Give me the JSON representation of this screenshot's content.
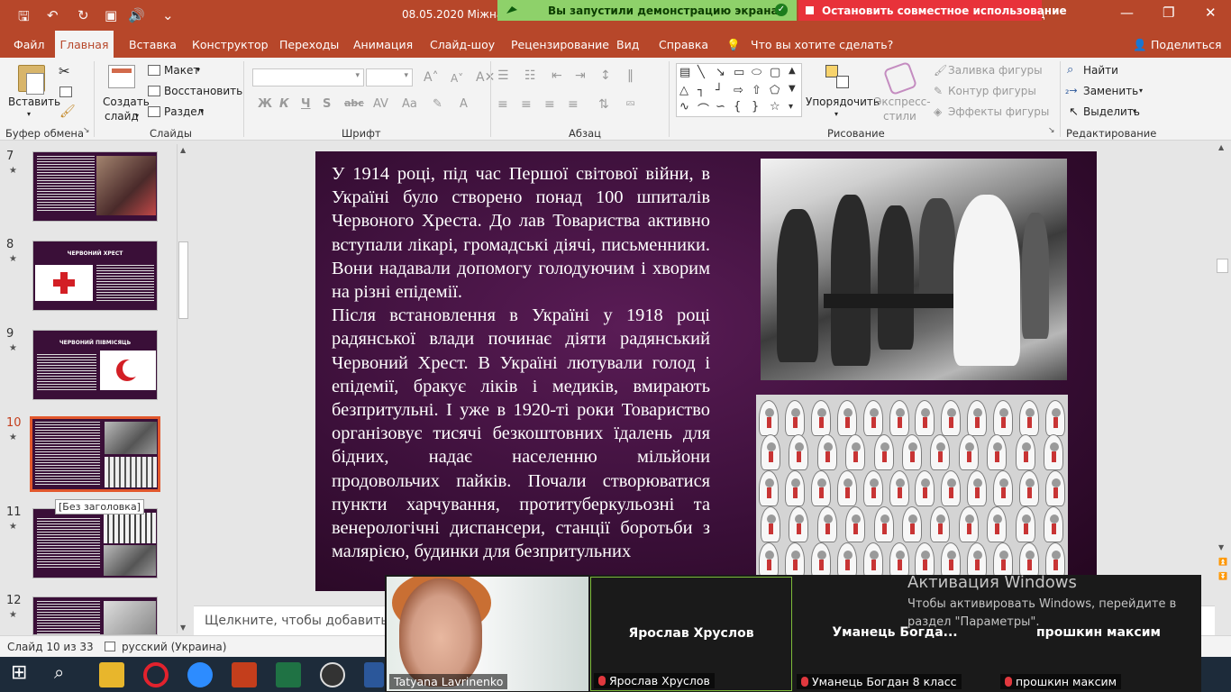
{
  "window": {
    "title": "08.05.2020 Міжнарод",
    "title_tail": "од"
  },
  "screen_share": {
    "status": "Вы запустили демонстрацию экрана",
    "stop_label": "Остановить совместное использование"
  },
  "menu": {
    "items": [
      "Файл",
      "Главная",
      "Вставка",
      "Конструктор",
      "Переходы",
      "Анимация",
      "Слайд-шоу",
      "Рецензирование",
      "Вид",
      "Справка"
    ],
    "active": "Главная",
    "tell_me": "Что вы хотите сделать?",
    "share": "Поделиться"
  },
  "ribbon": {
    "clipboard": {
      "paste": "Вставить",
      "label": "Буфер обмена"
    },
    "slides": {
      "new_slide_1": "Создать",
      "new_slide_2": "слайд",
      "layout": "Макет",
      "reset": "Восстановить",
      "section": "Раздел",
      "label": "Слайды"
    },
    "font": {
      "label": "Шрифт",
      "bold": "Ж",
      "italic": "К",
      "underline": "Ч",
      "strike": "S",
      "shadow": "abc"
    },
    "paragraph": {
      "label": "Абзац"
    },
    "drawing": {
      "arrange_1": "Упорядочить",
      "quick_1": "Экспресс-",
      "quick_2": "стили",
      "fill": "Заливка фигуры",
      "outline": "Контур фигуры",
      "effects": "Эффекты фигуры",
      "label": "Рисование"
    },
    "editing": {
      "find": "Найти",
      "replace": "Заменить",
      "select": "Выделить",
      "label": "Редактирование"
    }
  },
  "thumbnails": [
    {
      "num": "7",
      "title": ""
    },
    {
      "num": "8",
      "title": "ЧЕРВОНИЙ ХРЕСТ"
    },
    {
      "num": "9",
      "title": "ЧЕРВОНИЙ ПІВМІСЯЦЬ"
    },
    {
      "num": "10",
      "title": ""
    },
    {
      "num": "11",
      "title": ""
    },
    {
      "num": "12",
      "title": ""
    }
  ],
  "tooltip": "[Без заголовка]",
  "slide": {
    "paragraph_1": "У 1914 році, під час Першої світової війни, в Україні було створено понад 100 шпиталів Червоного Хреста. До лав Товариства активно вступали лікарі, громадські діячі, письменники. Вони надавали допомогу голодуючим і хворим на різні епідемії.",
    "paragraph_2": "Після встановлення в Україні у 1918 році радянської влади починає діяти радянський Червоний Хрест. В Україні лютували голод і епідемії, бракує ліків і медиків, вмирають безпритульні. І уже в 1920-ті роки Товариство організовує тисячі безкоштовних їдалень для бідних, надає населенню мільйони продовольчих пайків. Почали створюватися пункти харчування, протитуберкульозні та венерологічні диспансери, станції боротьби з малярією, будинки для безпритульних"
  },
  "notes_placeholder": "Щелкните, чтобы добавить за",
  "status": {
    "slide_count": "Слайд 10 из 33",
    "language": "русский (Украина)"
  },
  "participants": [
    {
      "tile_name": "",
      "label": "Tatyana Lavrinenko"
    },
    {
      "tile_name": "Ярослав Хруслов",
      "label": "Ярослав Хруслов"
    },
    {
      "tile_name": "Уманець  Богда...",
      "label": "Уманець Богдан 8 класс"
    },
    {
      "tile_name": "прошкин максим",
      "label": "прошкин максим"
    }
  ],
  "activation": {
    "title": "Активация Windows",
    "line1": "Чтобы активировать Windows, перейдите в",
    "line2": "раздел \"Параметры\"."
  },
  "colors": {
    "accent": "#b7472a",
    "slide_bg": "#3a0f38",
    "share_green": "#8ed16a",
    "stop_red": "#e8323a"
  }
}
